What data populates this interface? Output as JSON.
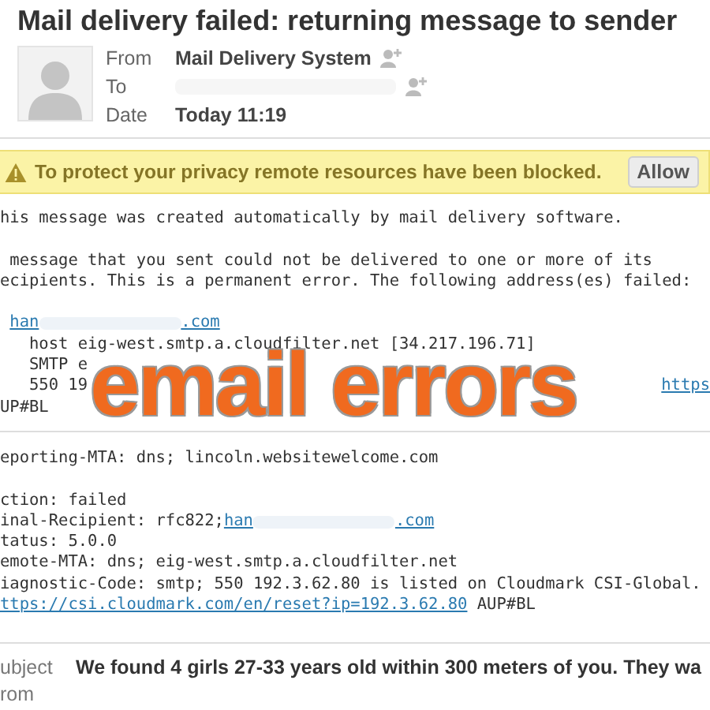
{
  "message": {
    "title": "Mail delivery failed: returning message to sender",
    "headers": [
      {
        "label": "From",
        "value": "Mail Delivery System",
        "add_contact": true
      },
      {
        "label": "To",
        "add_contact": true
      },
      {
        "label": "Date",
        "value": "Today 11:19",
        "add_contact": false
      }
    ]
  },
  "notice": {
    "text": "To protect your privacy remote resources have been blocked.",
    "button": "Allow"
  },
  "body_sections": [
    {
      "lines": [
        {
          "kind": "plain",
          "segments": [
            {
              "kind": "text",
              "text": "his message was created automatically by mail delivery software."
            }
          ]
        },
        {
          "kind": "blank"
        },
        {
          "kind": "plain",
          "segments": [
            {
              "kind": "text",
              "text": " message that you sent could not be delivered to one or more of its"
            }
          ]
        },
        {
          "kind": "plain",
          "segments": [
            {
              "kind": "text",
              "text": "ecipients. This is a permanent error. The following address(es) failed:"
            }
          ]
        },
        {
          "kind": "blank"
        },
        {
          "kind": "address",
          "segments": [
            {
              "kind": "link",
              "text": "han"
            },
            {
              "kind": "blur"
            },
            {
              "kind": "link",
              "text": ".com"
            }
          ]
        },
        {
          "kind": "nested",
          "segments": [
            {
              "kind": "text",
              "text": "host eig-west.smtp.a.cloudfilter.net [34.217.196.71]"
            }
          ]
        },
        {
          "kind": "nested",
          "segments": [
            {
              "kind": "text",
              "text": "SMTP e"
            }
          ]
        },
        {
          "kind": "nested",
          "segments": [
            {
              "kind": "text",
              "text": "550 19"
            },
            {
              "kind": "covered"
            },
            {
              "kind": "link",
              "text": "https"
            }
          ]
        },
        {
          "kind": "plain",
          "segments": [
            {
              "kind": "text",
              "text": "UP#BL"
            }
          ]
        }
      ]
    },
    {
      "lines": [
        {
          "kind": "plain",
          "segments": [
            {
              "kind": "text",
              "text": "eporting-MTA: dns; lincoln.websitewelcome.com"
            }
          ]
        },
        {
          "kind": "blank"
        },
        {
          "kind": "plain",
          "segments": [
            {
              "kind": "text",
              "text": "ction: failed"
            }
          ]
        },
        {
          "kind": "plain",
          "segments": [
            {
              "kind": "text",
              "text": "inal-Recipient: rfc822;"
            },
            {
              "kind": "link",
              "text": "han"
            },
            {
              "kind": "blur"
            },
            {
              "kind": "link",
              "text": ".com"
            }
          ]
        },
        {
          "kind": "plain",
          "segments": [
            {
              "kind": "text",
              "text": "tatus: 5.0.0"
            }
          ]
        },
        {
          "kind": "plain",
          "segments": [
            {
              "kind": "text",
              "text": "emote-MTA: dns; eig-west.smtp.a.cloudfilter.net"
            }
          ]
        },
        {
          "kind": "plain",
          "segments": [
            {
              "kind": "text",
              "text": "iagnostic-Code: smtp; 550 192.3.62.80 is listed on Cloudmark CSI-Global."
            }
          ]
        },
        {
          "kind": "plain",
          "segments": [
            {
              "kind": "link",
              "text": "ttps://csi.cloudmark.com/en/reset?ip=192.3.62.80"
            },
            {
              "kind": "text",
              "text": " AUP#BL"
            }
          ]
        }
      ]
    }
  ],
  "overlay": {
    "caption": "email errors"
  },
  "next_message": {
    "fields": [
      {
        "label": "ubject",
        "value": "We found 4 girls 27-33 years old within 300 meters of you. They wa"
      },
      {
        "label": "rom"
      }
    ]
  }
}
